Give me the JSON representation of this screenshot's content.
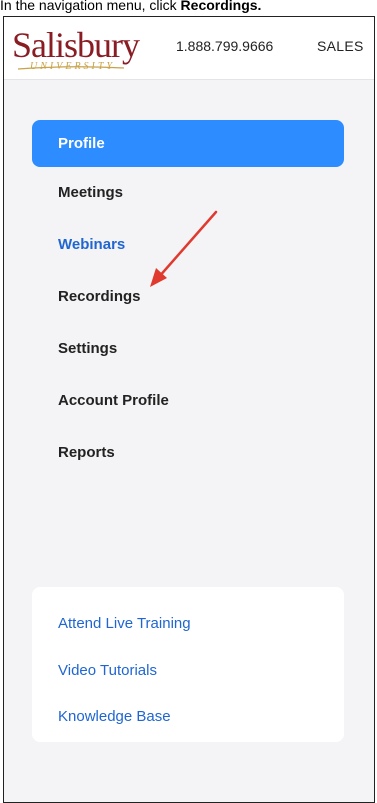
{
  "caption": {
    "prefix": "In the navigation menu, click ",
    "emphasis": "Recordings."
  },
  "header": {
    "logo_word": "Salisbury",
    "logo_sub": "UNIVERSITY",
    "phone": "1.888.799.9666",
    "sales": "SALES"
  },
  "nav": {
    "items": [
      {
        "label": "Profile",
        "state": "active"
      },
      {
        "label": "Meetings",
        "state": "normal"
      },
      {
        "label": "Webinars",
        "state": "link"
      },
      {
        "label": "Recordings",
        "state": "normal"
      },
      {
        "label": "Settings",
        "state": "normal"
      },
      {
        "label": "Account Profile",
        "state": "normal"
      },
      {
        "label": "Reports",
        "state": "normal"
      }
    ]
  },
  "help": {
    "items": [
      {
        "label": "Attend Live Training"
      },
      {
        "label": "Video Tutorials"
      },
      {
        "label": "Knowledge Base"
      }
    ]
  },
  "colors": {
    "active_bg": "#2d8cff",
    "link": "#1f66d1",
    "brand": "#8a1c23",
    "arrow": "#e03a2f"
  }
}
